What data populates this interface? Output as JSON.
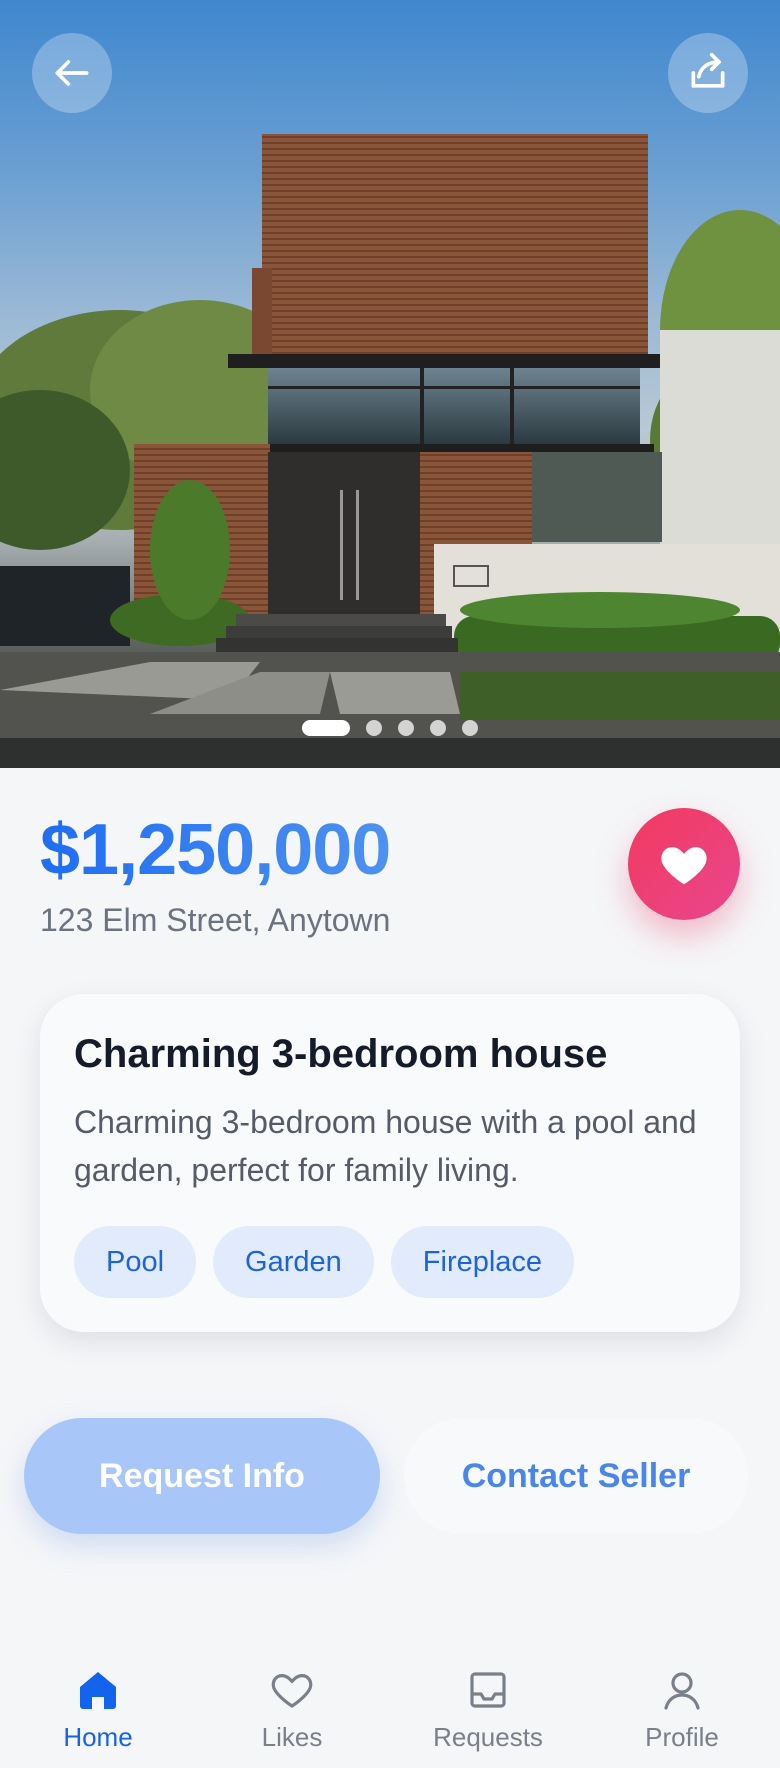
{
  "header": {
    "back_icon": "arrow-left-icon",
    "share_icon": "share-icon",
    "carousel": {
      "total": 5,
      "active": 1
    }
  },
  "listing": {
    "price": "$1,250,000",
    "address": "123 Elm Street, Anytown",
    "favorite_icon": "heart-icon",
    "title": "Charming 3-bedroom house",
    "description": "Charming 3-bedroom house with a pool and garden, perfect for family living.",
    "tags": [
      "Pool",
      "Garden",
      "Fireplace"
    ]
  },
  "actions": {
    "request_info": "Request Info",
    "contact_seller": "Contact Seller"
  },
  "nav": {
    "items": [
      {
        "label": "Home",
        "icon": "home-icon",
        "active": true
      },
      {
        "label": "Likes",
        "icon": "heart-outline-icon",
        "active": false
      },
      {
        "label": "Requests",
        "icon": "inbox-icon",
        "active": false
      },
      {
        "label": "Profile",
        "icon": "user-icon",
        "active": false
      }
    ]
  },
  "colors": {
    "accent": "#1463ec",
    "favorite": "#f03f6c",
    "tag_bg": "#e2ebfb"
  }
}
